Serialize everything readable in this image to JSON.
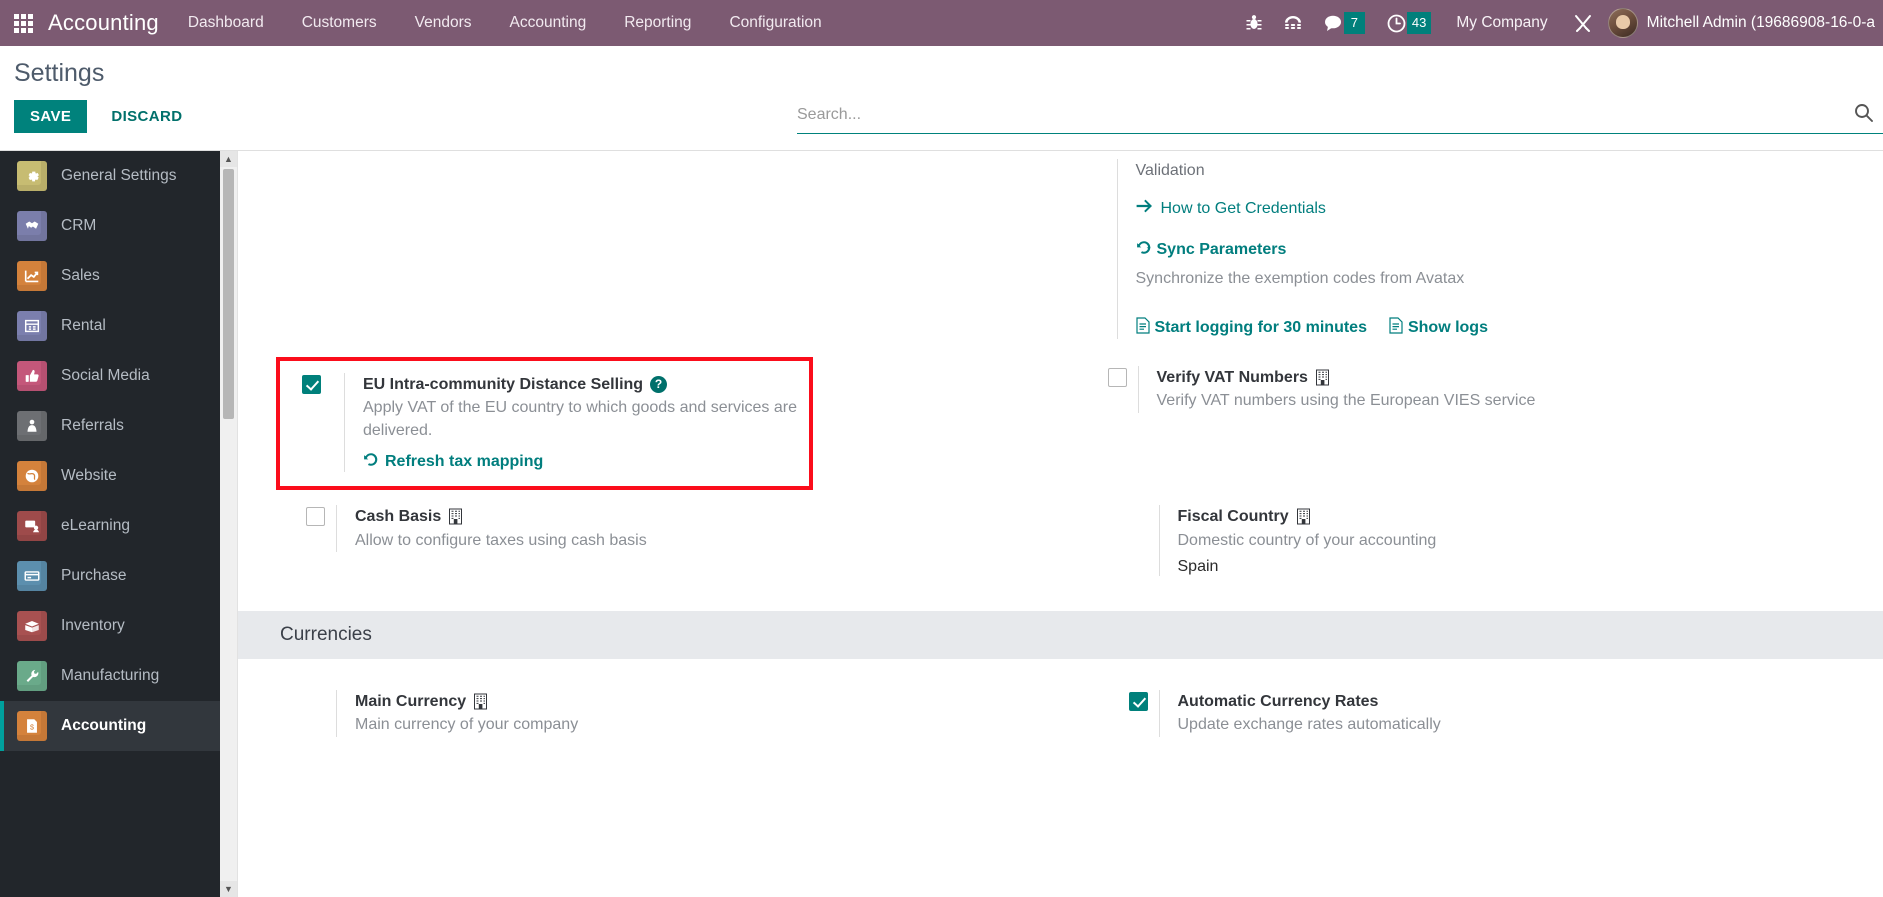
{
  "navbar": {
    "apps_icon": "apps-grid-icon",
    "brand": "Accounting",
    "menu": [
      {
        "label": "Dashboard"
      },
      {
        "label": "Customers"
      },
      {
        "label": "Vendors"
      },
      {
        "label": "Accounting"
      },
      {
        "label": "Reporting"
      },
      {
        "label": "Configuration"
      }
    ],
    "icons": [
      {
        "name": "bug-icon"
      },
      {
        "name": "phone-icon"
      }
    ],
    "messages": {
      "icon": "chat-icon",
      "count": "7"
    },
    "activities": {
      "icon": "clock-icon",
      "count": "43"
    },
    "company": "My Company",
    "debug_icon": "tools-icon",
    "user": "Mitchell Admin (19686908-16-0-a",
    "accent": "#7c5a72",
    "badge_color": "#00807b"
  },
  "control_panel": {
    "title": "Settings",
    "save_label": "SAVE",
    "discard_label": "DISCARD",
    "search_placeholder": "Search...",
    "search_value": "",
    "search_icon": "search-icon"
  },
  "sidebar": {
    "items": [
      {
        "label": "General Settings",
        "icon": "gear-icon",
        "color": "#c7bc72",
        "active": false
      },
      {
        "label": "CRM",
        "icon": "handshake-icon",
        "color": "#7b7eab",
        "active": false
      },
      {
        "label": "Sales",
        "icon": "chart-up-icon",
        "color": "#d4823c",
        "active": false
      },
      {
        "label": "Rental",
        "icon": "calendar-icon",
        "color": "#7b7fae",
        "active": false
      },
      {
        "label": "Social Media",
        "icon": "thumbs-up-icon",
        "color": "#c4577a",
        "active": false
      },
      {
        "label": "Referrals",
        "icon": "person-icon",
        "color": "#6d6f73",
        "active": false
      },
      {
        "label": "Website",
        "icon": "globe-icon",
        "color": "#d4823c",
        "active": false
      },
      {
        "label": "eLearning",
        "icon": "presentation-icon",
        "color": "#9e4b4b",
        "active": false
      },
      {
        "label": "Purchase",
        "icon": "card-icon",
        "color": "#5c8fae",
        "active": false
      },
      {
        "label": "Inventory",
        "icon": "box-icon",
        "color": "#a85151",
        "active": false
      },
      {
        "label": "Manufacturing",
        "icon": "wrench-icon",
        "color": "#6aaa8a",
        "active": false
      },
      {
        "label": "Accounting",
        "icon": "invoice-icon",
        "color": "#d4823c",
        "active": true
      }
    ],
    "scroll_up": "▲",
    "scroll_down": "▼"
  },
  "avatax": {
    "validation_label": "Validation",
    "credentials_link": "How to Get Credentials",
    "credentials_icon": "arrow-right-icon",
    "sync_title": "Sync Parameters",
    "sync_icon": "refresh-icon",
    "sync_desc": "Synchronize the exemption codes from Avatax",
    "start_logging": "Start logging for 30 minutes",
    "start_logging_icon": "file-icon",
    "show_logs": "Show logs",
    "show_logs_icon": "file-icon"
  },
  "settings": {
    "eu_distance_selling": {
      "checked": true,
      "title": "EU Intra-community Distance Selling",
      "help_icon": "question-mark-icon",
      "description": "Apply VAT of the EU country to which goods and services are delivered.",
      "action_label": "Refresh tax mapping",
      "action_icon": "refresh-icon",
      "highlight_color": "#fb0d1b"
    },
    "verify_vat": {
      "checked": false,
      "title": "Verify VAT Numbers",
      "company_icon": "company-building-icon",
      "description": "Verify VAT numbers using the European VIES service"
    },
    "cash_basis": {
      "checked": false,
      "title": "Cash Basis",
      "company_icon": "company-building-icon",
      "description": "Allow to configure taxes using cash basis"
    },
    "fiscal_country": {
      "title": "Fiscal Country",
      "company_icon": "company-building-icon",
      "description": "Domestic country of your accounting",
      "value": "Spain"
    }
  },
  "currencies_section": {
    "heading": "Currencies",
    "main_currency": {
      "title": "Main Currency",
      "company_icon": "company-building-icon",
      "description": "Main currency of your company"
    },
    "automatic_rates": {
      "checked": true,
      "title": "Automatic Currency Rates",
      "description": "Update exchange rates automatically"
    }
  }
}
